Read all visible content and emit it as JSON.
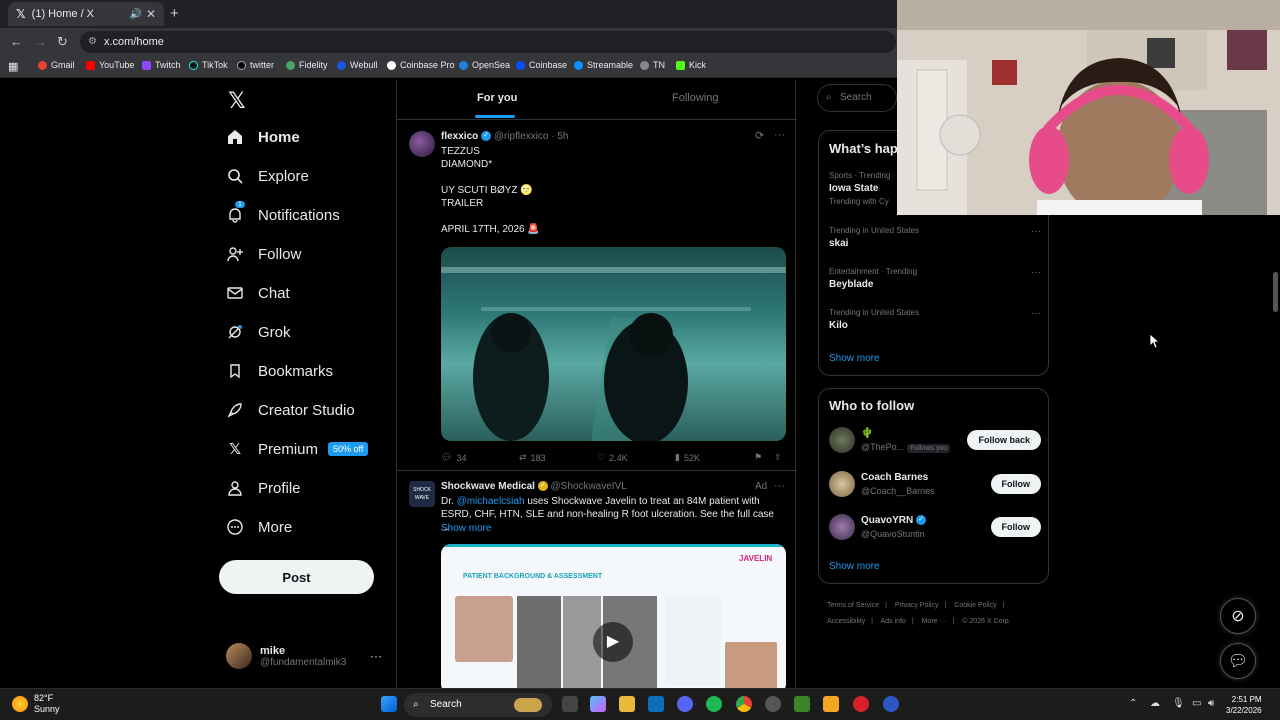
{
  "browser": {
    "tab_title": "(1) Home / X",
    "url": "x.com/home",
    "bookmarks": [
      "Gmail",
      "YouTube",
      "Twitch",
      "TikTok",
      "twitter",
      "Fidelity",
      "Webull",
      "Coinbase Pro",
      "OpenSea",
      "Coinbase",
      "Streamable",
      "TN",
      "Kick"
    ]
  },
  "sidebar": {
    "items": [
      {
        "label": "Home",
        "icon": "home-icon"
      },
      {
        "label": "Explore",
        "icon": "search-icon"
      },
      {
        "label": "Notifications",
        "icon": "bell-icon",
        "badge": "1"
      },
      {
        "label": "Follow",
        "icon": "add-person-icon"
      },
      {
        "label": "Chat",
        "icon": "envelope-icon"
      },
      {
        "label": "Grok",
        "icon": "grok-icon"
      },
      {
        "label": "Bookmarks",
        "icon": "bookmark-icon"
      },
      {
        "label": "Creator Studio",
        "icon": "rocket-icon"
      },
      {
        "label": "Premium",
        "icon": "x-icon",
        "badge": "50% off"
      },
      {
        "label": "Profile",
        "icon": "person-icon"
      },
      {
        "label": "More",
        "icon": "more-circle-icon"
      }
    ],
    "post_label": "Post",
    "account": {
      "name": "mike",
      "handle": "@fundamentalmik3"
    }
  },
  "feed": {
    "tabs": [
      "For you",
      "Following"
    ],
    "tweets": [
      {
        "author": "flexxico",
        "handle": "@ripflexxico",
        "time": "· 5h",
        "text": "TEZZUS\nDIAMOND*\n\nUY SCUTI BØYZ 🌝\nTRAILER\n\nAPRIL 17TH, 2026 🚨",
        "replies": "34",
        "reposts": "183",
        "likes": "2.4K",
        "views": "52K"
      },
      {
        "author": "Shockwave Medical",
        "handle": "@ShockwaveIVL",
        "ad": "Ad",
        "mention": "@michaelcsiah",
        "text_pre": "Dr.",
        "text": "uses Shockwave Javelin to treat an 84M patient with ESRD, CHF, HTN, SLE and non-healing R foot ulceration. See the full case ...",
        "show_more": "Show more",
        "media_title": "PATIENT BACKGROUND & ASSESSMENT",
        "media_brand": "JAVELIN"
      }
    ]
  },
  "right": {
    "search_placeholder": "Search",
    "trends_title": "What’s happening",
    "trends": [
      {
        "meta": "Sports · Trending",
        "title": "Iowa State",
        "sub": "Trending with Cy"
      },
      {
        "meta": "Trending in United States",
        "title": "skai"
      },
      {
        "meta": "Entertainment · Trending",
        "title": "Beyblade"
      },
      {
        "meta": "Trending in United States",
        "title": "Kilo"
      }
    ],
    "show_more": "Show more",
    "wtf_title": "Who to follow",
    "wtf": [
      {
        "name": "🌵",
        "handle": "@ThePo...",
        "follows_you": "Follows you",
        "button": "Follow back"
      },
      {
        "name": "Coach Barnes",
        "handle": "@Coach__Barnes",
        "button": "Follow"
      },
      {
        "name": "QuavoYRN",
        "handle": "@QuavoStuntin",
        "button": "Follow"
      }
    ],
    "footer": [
      "Terms of Service",
      "Privacy Policy",
      "Cookie Policy",
      "Accessibility",
      "Ads info",
      "More ···",
      "© 2026 X Corp."
    ]
  },
  "taskbar": {
    "weather_temp": "82°F",
    "weather_desc": "Sunny",
    "search_label": "Search",
    "time": "2:51 PM",
    "date": "3/22/2026"
  },
  "colors": {
    "accent": "#1d9bf0",
    "bg": "#000000",
    "border": "#2f3336"
  }
}
